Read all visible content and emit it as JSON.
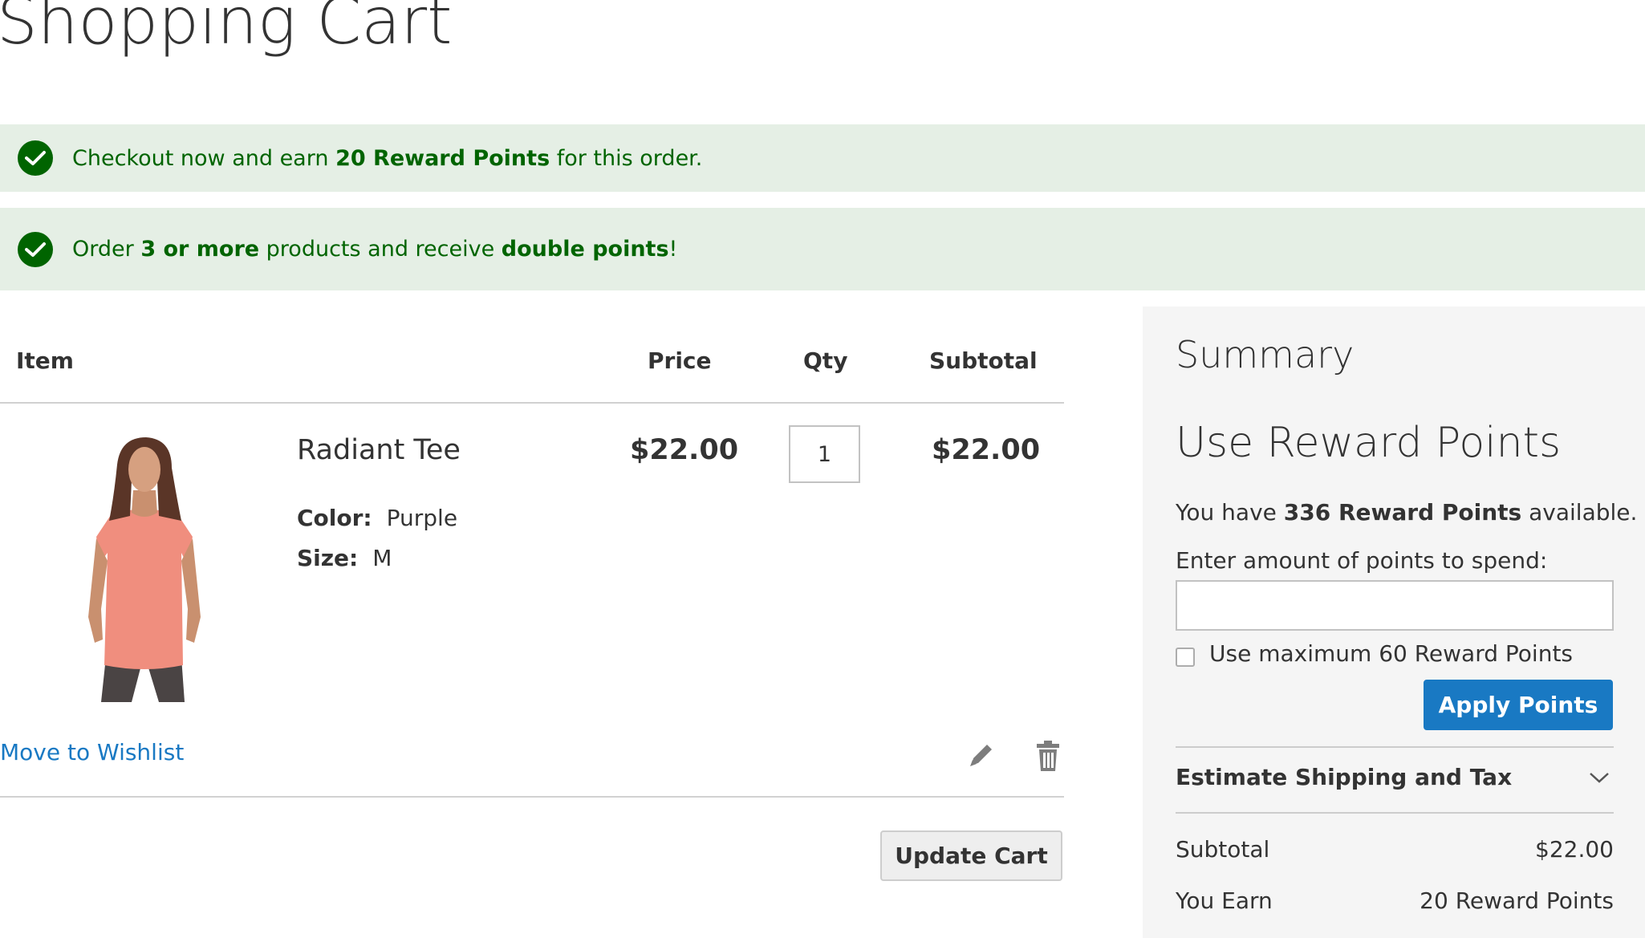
{
  "page": {
    "title": "Shopping Cart"
  },
  "notices": {
    "earn": {
      "prefix": "Checkout now and earn ",
      "highlight": "20 Reward Points",
      "suffix": " for this order."
    },
    "double": {
      "prefix": "Order ",
      "highlight1": "3 or more",
      "middle": " products and receive ",
      "highlight2": "double points",
      "suffix": "!"
    }
  },
  "cart": {
    "columns": {
      "item": "Item",
      "price": "Price",
      "qty": "Qty",
      "subtotal": "Subtotal"
    },
    "items": [
      {
        "name": "Radiant Tee",
        "options": [
          {
            "label": "Color:",
            "value": "Purple"
          },
          {
            "label": "Size:",
            "value": "M"
          }
        ],
        "price": "$22.00",
        "qty": "1",
        "subtotal": "$22.00"
      }
    ],
    "move_to_wishlist": "Move to Wishlist",
    "update_cart_label": "Update Cart"
  },
  "summary": {
    "title": "Summary",
    "reward": {
      "title": "Use Reward Points",
      "available_prefix": "You have ",
      "available_highlight": "336 Reward Points",
      "available_suffix": " available.",
      "input_label": "Enter amount of points to spend:",
      "max_label": "Use maximum 60 Reward Points",
      "apply_label": "Apply Points"
    },
    "estimate_label": "Estimate Shipping and Tax",
    "totals": {
      "subtotal_label": "Subtotal",
      "subtotal_value": "$22.00",
      "earn_label": "You Earn",
      "earn_value": "20 Reward Points"
    }
  },
  "colors": {
    "notice_bg": "#e5efe5",
    "notice_text": "#006400",
    "link": "#1979c3",
    "primary_button": "#1979c3",
    "summary_bg": "#f5f5f5"
  },
  "icons": {
    "notice": "check-circle-icon",
    "edit": "pencil-icon",
    "delete": "trash-icon",
    "estimate_toggle": "chevron-down-icon"
  }
}
